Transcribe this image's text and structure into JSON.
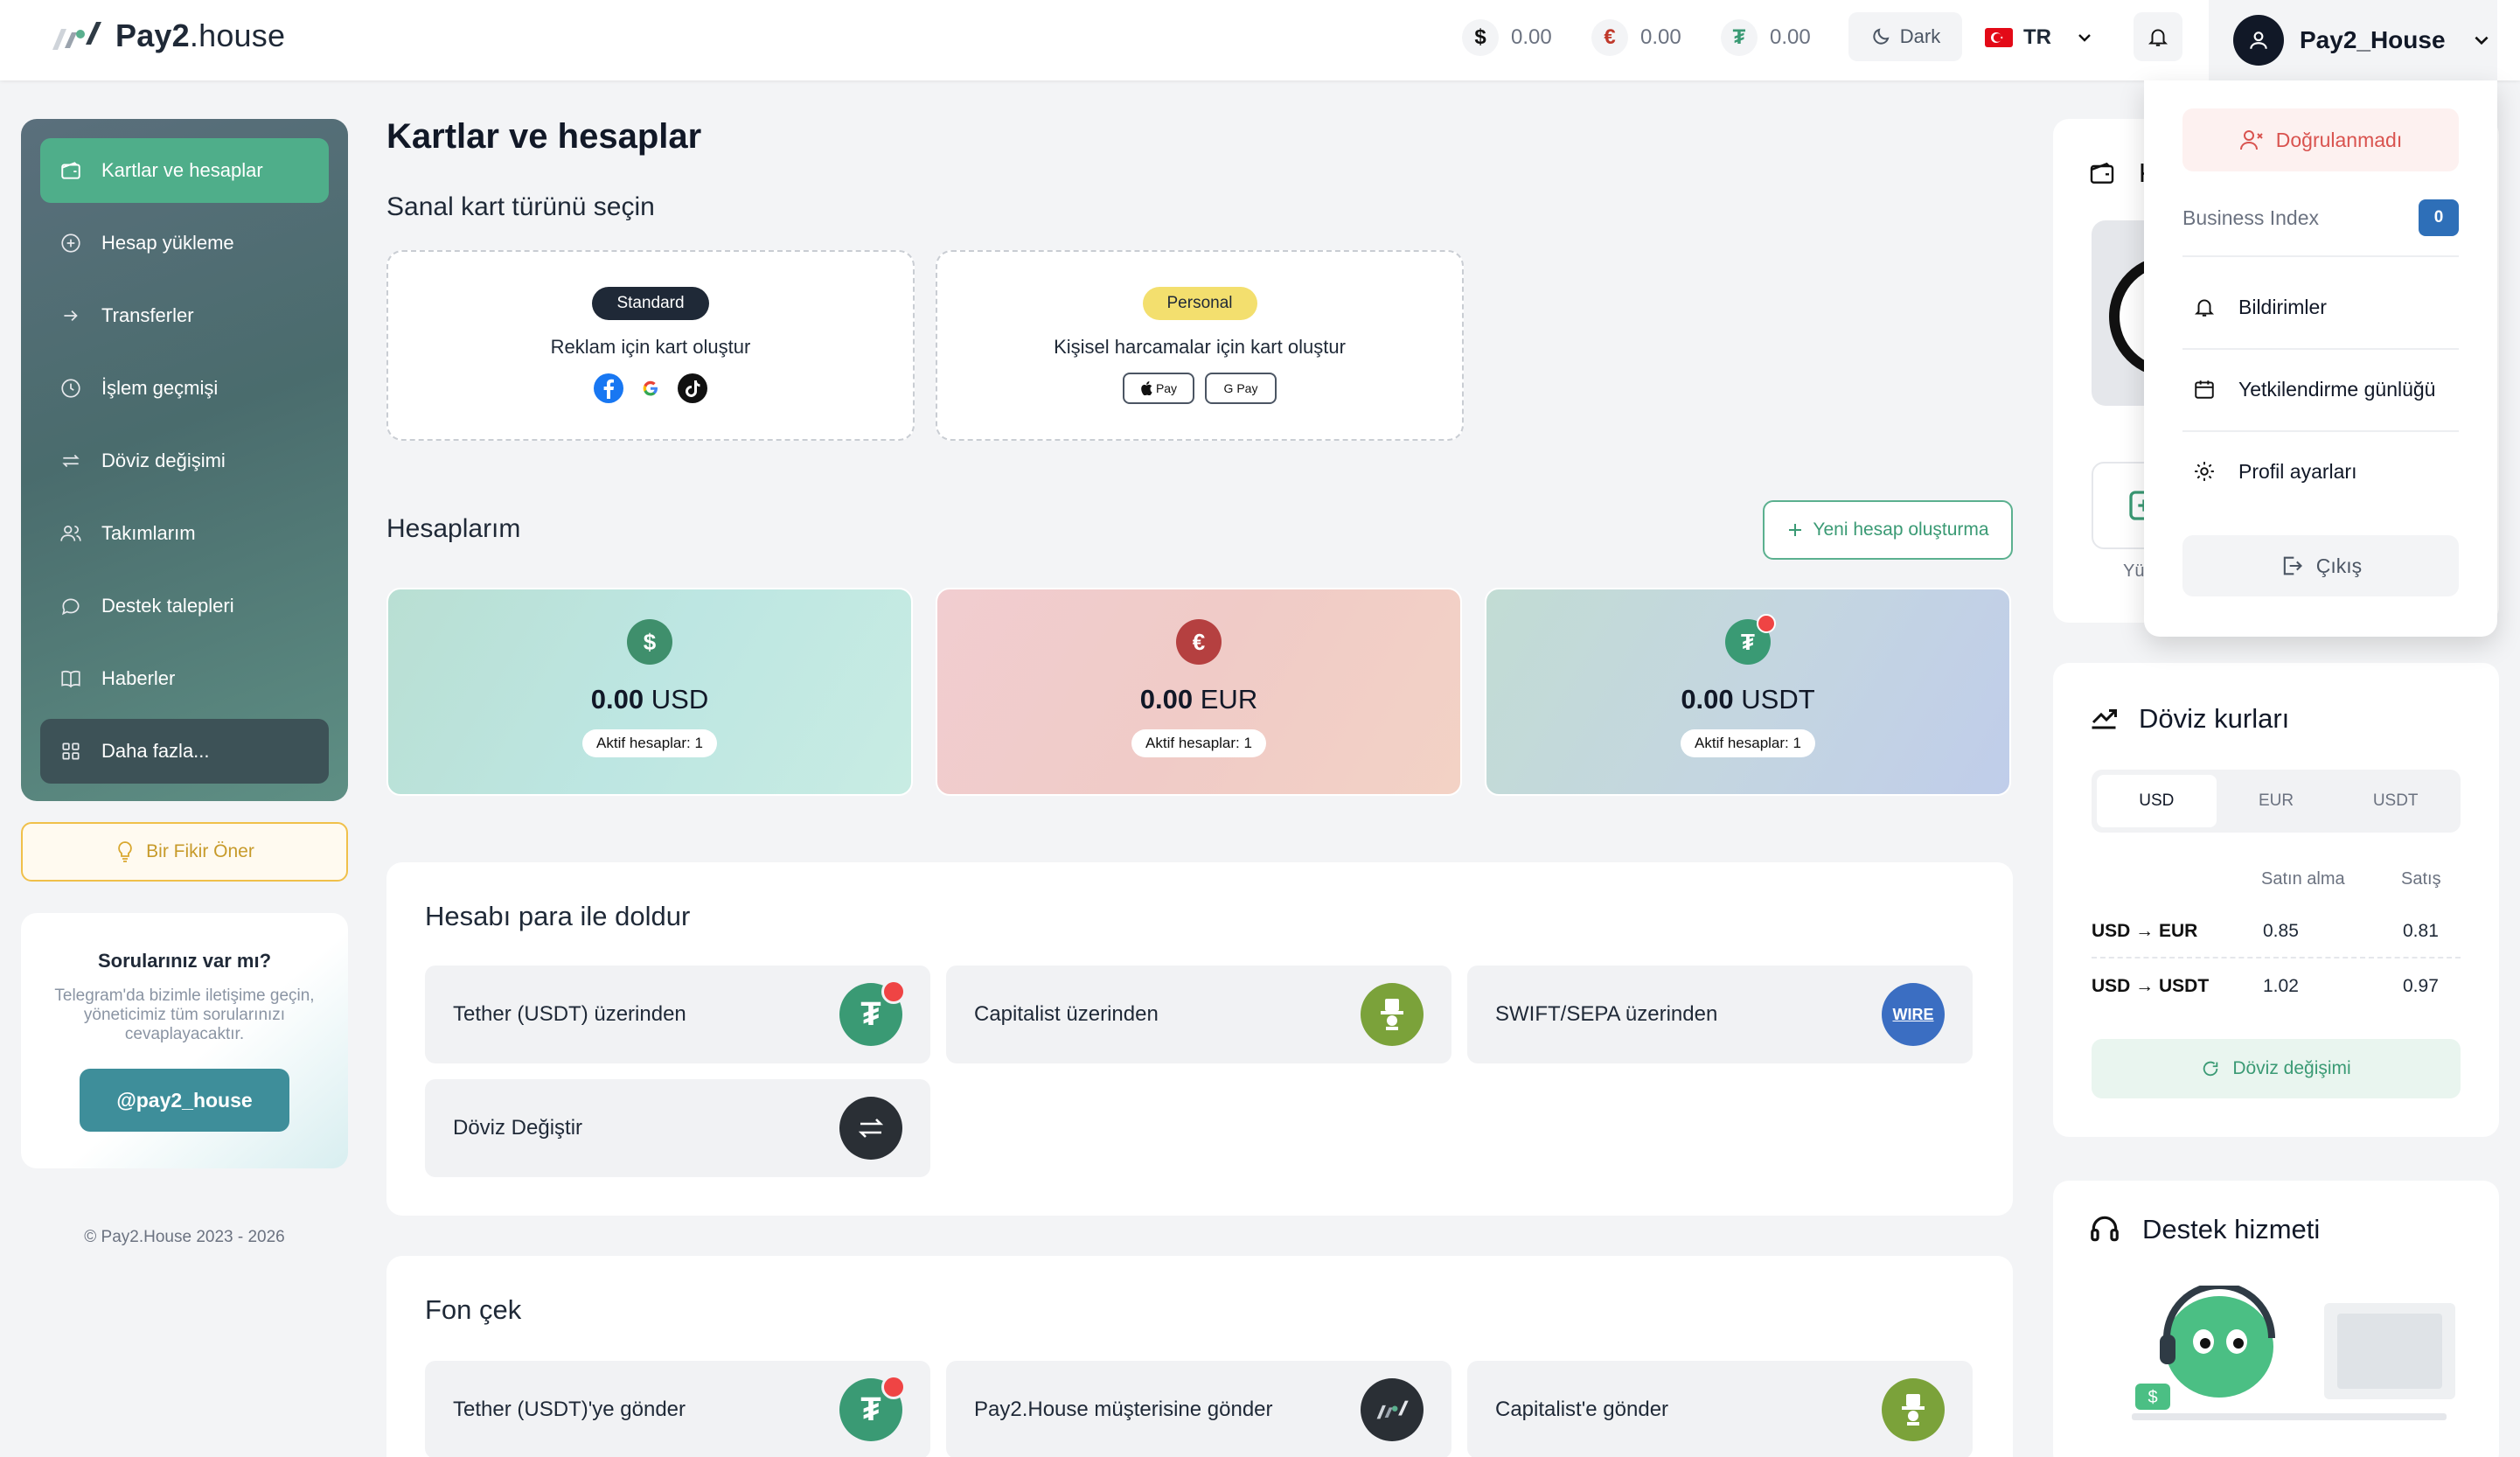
{
  "app": {
    "brand_bold": "Pay2",
    "brand_rest": ".house"
  },
  "header": {
    "balances": [
      {
        "symbol": "$",
        "value": "0.00",
        "icon": "dollar-icon"
      },
      {
        "symbol": "€",
        "value": "0.00",
        "icon": "euro-icon"
      },
      {
        "symbol": "₮",
        "value": "0.00",
        "icon": "tether-icon"
      }
    ],
    "theme_label": "Dark",
    "language": "TR",
    "username": "Pay2_House"
  },
  "sidebar": {
    "items": [
      {
        "label": "Kartlar ve hesaplar",
        "icon": "wallet-icon"
      },
      {
        "label": "Hesap yükleme",
        "icon": "plus-circle-icon"
      },
      {
        "label": "Transferler",
        "icon": "arrow-right-icon"
      },
      {
        "label": "İşlem geçmişi",
        "icon": "clock-icon"
      },
      {
        "label": "Döviz değişimi",
        "icon": "swap-icon"
      },
      {
        "label": "Takımlarım",
        "icon": "team-icon"
      },
      {
        "label": "Destek talepleri",
        "icon": "chat-icon"
      },
      {
        "label": "Haberler",
        "icon": "book-icon"
      },
      {
        "label": "Daha fazla...",
        "icon": "grid-icon"
      }
    ],
    "idea_button": "Bir Fikir Öner",
    "telegram": {
      "title": "Sorularınız var mı?",
      "text": "Telegram'da bizimle iletişime geçin, yöneticimiz tüm sorularınızı cevaplayacaktır.",
      "button": "@pay2_house"
    },
    "copyright": "© Pay2.House 2023 - 2026"
  },
  "main": {
    "title": "Kartlar ve hesaplar",
    "card_type_title": "Sanal kart türünü seçin",
    "card_types": [
      {
        "badge": "Standard",
        "text": "Reklam için kart oluştur"
      },
      {
        "badge": "Personal",
        "text": "Kişisel harcamalar için kart oluştur",
        "pay_labels": [
          "Pay",
          "G Pay"
        ]
      }
    ],
    "accounts_title": "Hesaplarım",
    "new_account_button": "Yeni hesap oluşturma",
    "accounts": [
      {
        "symbol": "$",
        "amount": "0.00",
        "currency": "USD",
        "active": "Aktif hesaplar: 1"
      },
      {
        "symbol": "€",
        "amount": "0.00",
        "currency": "EUR",
        "active": "Aktif hesaplar: 1"
      },
      {
        "symbol": "₮",
        "amount": "0.00",
        "currency": "USDT",
        "active": "Aktif hesaplar: 1"
      }
    ],
    "topup": {
      "title": "Hesabı para ile doldur",
      "options": [
        {
          "label": "Tether (USDT) üzerinden",
          "icon": "tether-icon"
        },
        {
          "label": "Capitalist üzerinden",
          "icon": "capitalist-icon"
        },
        {
          "label": "SWIFT/SEPA üzerinden",
          "icon": "wire-icon",
          "icon_text": "WIRE"
        },
        {
          "label": "Döviz Değiştir",
          "icon": "swap-icon"
        }
      ]
    },
    "withdraw": {
      "title": "Fon çek",
      "options": [
        {
          "label": "Tether (USDT)'ye gönder",
          "icon": "tether-icon"
        },
        {
          "label": "Pay2.House müşterisine gönder",
          "icon": "pay2-logo-icon"
        },
        {
          "label": "Capitalist'e gönder",
          "icon": "capitalist-icon"
        }
      ]
    }
  },
  "right": {
    "top_card": {
      "title_initial": "K",
      "tile_label": "Yü"
    },
    "rates": {
      "title": "Döviz kurları",
      "tabs": [
        "USD",
        "EUR",
        "USDT"
      ],
      "col_buy": "Satın alma",
      "col_sell": "Satış",
      "rows": [
        {
          "pair": "USD → EUR",
          "buy": "0.85",
          "sell": "0.81"
        },
        {
          "pair": "USD → USDT",
          "buy": "1.02",
          "sell": "0.97"
        }
      ],
      "button": "Döviz değişimi"
    },
    "support": {
      "title": "Destek hizmeti"
    }
  },
  "dropdown": {
    "verify": "Doğrulanmadı",
    "business_index_label": "Business Index",
    "business_index_value": "0",
    "items": [
      {
        "label": "Bildirimler",
        "icon": "bell-icon"
      },
      {
        "label": "Yetkilendirme günlüğü",
        "icon": "calendar-icon"
      },
      {
        "label": "Profil ayarları",
        "icon": "gear-icon"
      }
    ],
    "logout": "Çıkış"
  },
  "colors": {
    "accent": "#4fae8a",
    "usd": "#3f8f6c",
    "eur": "#b54040",
    "usdt": "#3a9a74",
    "danger": "#d9534f"
  }
}
